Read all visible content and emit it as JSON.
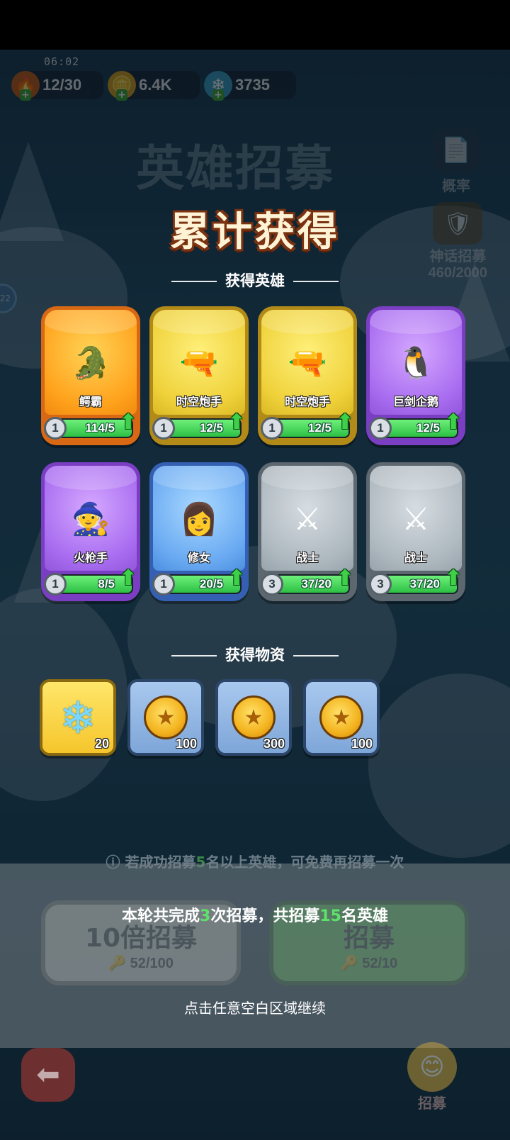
{
  "status": {
    "time": "06:02",
    "stamina": "12/30",
    "gold": "6.4K",
    "gems": "3735"
  },
  "header": {
    "faded_title": "英雄招募",
    "probability_label": "概率",
    "myth_recruit_label": "神话招募",
    "myth_recruit_count": "460/2000",
    "side_chip": "22"
  },
  "result": {
    "title": "累计获得",
    "heroes_section": "获得英雄",
    "items_section": "获得物资",
    "heroes": [
      {
        "name": "鳄霸",
        "level": "1",
        "count": "114/5",
        "progress": 1.0,
        "rarity": "orange",
        "icon": "crocodile-icon"
      },
      {
        "name": "时空炮手",
        "level": "1",
        "count": "12/5",
        "progress": 1.0,
        "rarity": "gold",
        "icon": "gunner-icon"
      },
      {
        "name": "时空炮手",
        "level": "1",
        "count": "12/5",
        "progress": 1.0,
        "rarity": "gold",
        "icon": "gunner-icon"
      },
      {
        "name": "巨剑企鹅",
        "level": "1",
        "count": "12/5",
        "progress": 1.0,
        "rarity": "purple",
        "icon": "penguin-icon"
      },
      {
        "name": "火枪手",
        "level": "1",
        "count": "8/5",
        "progress": 1.0,
        "rarity": "purple",
        "icon": "wizard-icon"
      },
      {
        "name": "修女",
        "level": "1",
        "count": "20/5",
        "progress": 1.0,
        "rarity": "blue",
        "icon": "nun-icon"
      },
      {
        "name": "战士",
        "level": "3",
        "count": "37/20",
        "progress": 1.0,
        "rarity": "grey",
        "icon": "warrior-icon"
      },
      {
        "name": "战士",
        "level": "3",
        "count": "37/20",
        "progress": 1.0,
        "rarity": "grey",
        "icon": "warrior-icon"
      }
    ],
    "items": [
      {
        "icon": "crystal-icon",
        "qty": "20",
        "frame": "gold"
      },
      {
        "icon": "coin-icon",
        "qty": "100",
        "frame": "blue"
      },
      {
        "icon": "coin-icon",
        "qty": "300",
        "frame": "blue"
      },
      {
        "icon": "coin-icon",
        "qty": "100",
        "frame": "blue"
      }
    ],
    "summary_pre": "本轮共完成",
    "summary_times": "3",
    "summary_mid": "次招募，共招募",
    "summary_heroes": "15",
    "summary_post": "名英雄",
    "continue_hint": "点击任意空白区域继续"
  },
  "background": {
    "notice_pre": "若成功招募",
    "notice_num": "5",
    "notice_post": "名以上英雄，可免费再招募一次",
    "ten_label": "10倍招募",
    "ten_keys": "52/100",
    "one_label": "招募",
    "one_keys": "52/10",
    "tab_label": "招募"
  },
  "colors": {
    "progress_fill": "#2cc044",
    "highlight_number": "#5ee06a",
    "title_outline": "#7a3210"
  }
}
